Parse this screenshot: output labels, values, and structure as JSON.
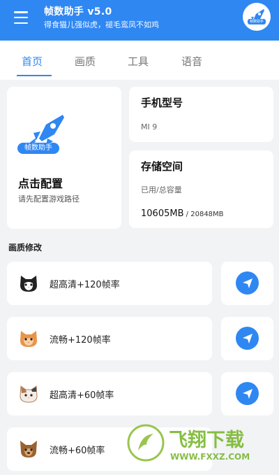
{
  "app": {
    "title": "帧数助手 v5.0",
    "subtitle": "得食猫儿强似虎，褪毛鸾凤不如鸡",
    "logo_badge": "帧数助手"
  },
  "tabs": [
    {
      "label": "首页"
    },
    {
      "label": "画质"
    },
    {
      "label": "工具"
    },
    {
      "label": "语音"
    }
  ],
  "active_tab": "首页",
  "config": {
    "badge": "帧数助手",
    "title": "点击配置",
    "subtitle": "请先配置游戏路径"
  },
  "phone": {
    "label": "手机型号",
    "value": "MI 9"
  },
  "storage": {
    "label": "存储空间",
    "caption": "已用/总容量",
    "used": "10605MB",
    "total": " / 20848MB"
  },
  "section": {
    "title": "画质修改"
  },
  "presets": [
    {
      "label": "超高清+120帧率",
      "icon": "black-white-cat-icon"
    },
    {
      "label": "流畅+120帧率",
      "icon": "orange-cat-icon"
    },
    {
      "label": "超高清+60帧率",
      "icon": "calico-cat-icon"
    },
    {
      "label": "流畅+60帧率",
      "icon": "brown-dog-icon"
    }
  ],
  "watermark": {
    "text": "飞翔下载",
    "url_text": "WWW.FXXZ.COM"
  },
  "colors": {
    "accent": "#2f87f2",
    "background": "#f2f3f5"
  }
}
